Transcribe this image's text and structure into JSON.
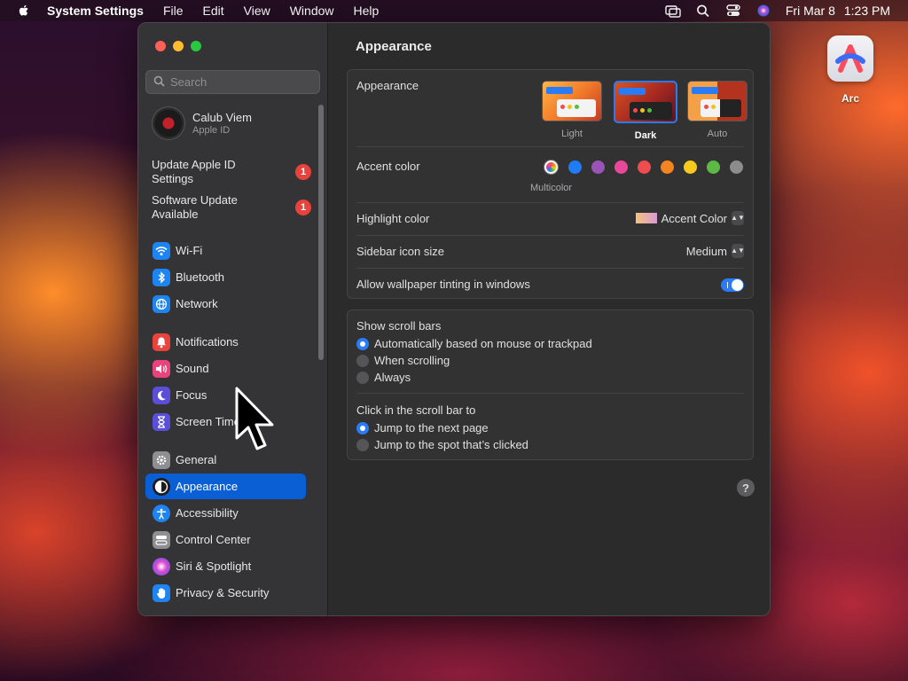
{
  "menubar": {
    "app_name": "System Settings",
    "menus": [
      "File",
      "Edit",
      "View",
      "Window",
      "Help"
    ],
    "date": "Fri Mar 8",
    "time": "1:23 PM"
  },
  "desktop": {
    "icon_label": "Arc"
  },
  "sidebar": {
    "search_placeholder": "Search",
    "account_name": "Calub Viem",
    "account_sub": "Apple ID",
    "notices": [
      {
        "label": "Update Apple ID Settings",
        "badge": "1"
      },
      {
        "label": "Software Update Available",
        "badge": "1"
      }
    ],
    "items": [
      {
        "label": "Wi-Fi",
        "icon": "wifi-icon",
        "color": "#1e84f2"
      },
      {
        "label": "Bluetooth",
        "icon": "bluetooth-icon",
        "color": "#1e84f2"
      },
      {
        "label": "Network",
        "icon": "globe-icon",
        "color": "#1e84f2"
      },
      {
        "label": "Notifications",
        "icon": "bell-icon",
        "color": "#e8433c"
      },
      {
        "label": "Sound",
        "icon": "speaker-icon",
        "color": "#e8437a"
      },
      {
        "label": "Focus",
        "icon": "moon-icon",
        "color": "#5b4fd9"
      },
      {
        "label": "Screen Time",
        "icon": "hourglass-icon",
        "color": "#5b4fd9"
      },
      {
        "label": "General",
        "icon": "gear-icon",
        "color": "#8e8e93"
      },
      {
        "label": "Appearance",
        "icon": "appearance-icon",
        "color": "#1c1c1e"
      },
      {
        "label": "Accessibility",
        "icon": "accessibility-icon",
        "color": "#1e84f2"
      },
      {
        "label": "Control Center",
        "icon": "control-center-icon",
        "color": "#8e8e93"
      },
      {
        "label": "Siri & Spotlight",
        "icon": "siri-icon",
        "color": "#b03ad8"
      },
      {
        "label": "Privacy & Security",
        "icon": "hand-icon",
        "color": "#1e84f2"
      }
    ],
    "active_item": "Appearance"
  },
  "main": {
    "title": "Appearance",
    "appearance_label": "Appearance",
    "themes": [
      {
        "label": "Light",
        "selected": false
      },
      {
        "label": "Dark",
        "selected": true
      },
      {
        "label": "Auto",
        "selected": false
      }
    ],
    "accent_label": "Accent color",
    "accent_colors": [
      "multicolor",
      "#1f7cf5",
      "#9a54b8",
      "#e7489a",
      "#ee4c4f",
      "#f2851f",
      "#f7c91c",
      "#5bb944",
      "#8c8c8c"
    ],
    "multicolor_label": "Multicolor",
    "highlight_label": "Highlight color",
    "highlight_value": "Accent Color",
    "icon_size_label": "Sidebar icon size",
    "icon_size_value": "Medium",
    "tinting_label": "Allow wallpaper tinting in windows",
    "tinting_on": true,
    "scrollbars_title": "Show scroll bars",
    "scrollbars_options": [
      {
        "label": "Automatically based on mouse or trackpad",
        "selected": true
      },
      {
        "label": "When scrolling",
        "selected": false
      },
      {
        "label": "Always",
        "selected": false
      }
    ],
    "click_title": "Click in the scroll bar to",
    "click_options": [
      {
        "label": "Jump to the next page",
        "selected": true
      },
      {
        "label": "Jump to the spot that’s clicked",
        "selected": false
      }
    ],
    "help": "?"
  }
}
